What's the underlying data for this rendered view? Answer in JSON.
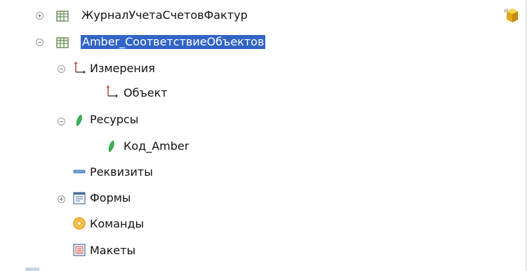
{
  "tree": {
    "items": [
      {
        "label": "ЖурналУчетаСчетовФактур",
        "icon": "table-icon",
        "expander": "plus"
      },
      {
        "label": "Amber_СоответствиеОбъектов",
        "icon": "table-icon",
        "expander": "minus",
        "selected": true
      },
      {
        "label": "Измерения",
        "icon": "dimensions-icon",
        "expander": "minus"
      },
      {
        "label": "Объект",
        "icon": "dimension-icon",
        "expander": ""
      },
      {
        "label": "Ресурсы",
        "icon": "resources-icon",
        "expander": "minus"
      },
      {
        "label": "Код_Amber",
        "icon": "resource-icon",
        "expander": ""
      },
      {
        "label": "Реквизиты",
        "icon": "attributes-icon",
        "expander": ""
      },
      {
        "label": "Формы",
        "icon": "forms-icon",
        "expander": "plus"
      },
      {
        "label": "Команды",
        "icon": "commands-icon",
        "expander": ""
      },
      {
        "label": "Макеты",
        "icon": "templates-icon",
        "expander": ""
      }
    ]
  },
  "colors": {
    "selection": "#3164c5",
    "resource_green": "#39b54a",
    "commands_orange": "#f0a020"
  }
}
